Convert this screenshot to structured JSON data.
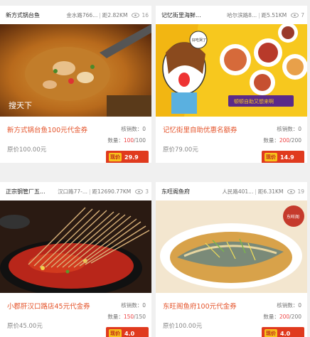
{
  "cards": [
    {
      "shop": "新方式锅台鱼",
      "address": "金水路766...",
      "distance": "距2.82KM",
      "views": "16",
      "title": "新方式锅台鱼100元代金券",
      "sold_label": "核销数：0",
      "qty_label": "数量：",
      "qty_used": "100",
      "qty_total": "/100",
      "original": "原价100.00元",
      "price_tag": "现价",
      "price": "29.9",
      "watermark": "搜天下"
    },
    {
      "shop": "记忆街里海鲜...",
      "address": "哈尔滨路8...",
      "distance": "距5.51KM",
      "views": "7",
      "title": "记忆街里自助优惠名额券",
      "sold_label": "核销数：0",
      "qty_label": "数量：",
      "qty_used": "200",
      "qty_total": "/200",
      "original": "原价79.00元",
      "price_tag": "现价",
      "price": "14.9",
      "bubble": "好吃哭了",
      "banner": "顿顿自助又想来啊"
    },
    {
      "shop": "正宗钢管厂五...",
      "address": "汉口路77-...",
      "distance": "距12690.77KM",
      "views": "3",
      "title": "小郡肝汉口路店45元代金券",
      "sold_label": "核销数：0",
      "qty_label": "数量：",
      "qty_used": "150",
      "qty_total": "/150",
      "original": "原价45.00元",
      "price_tag": "现价",
      "price": "4.0"
    },
    {
      "shop": "东旺阁鱼府",
      "address": "人民路401...",
      "distance": "距6.31KM",
      "views": "19",
      "title": "东旺阁鱼府100元代金券",
      "sold_label": "核销数：0",
      "qty_label": "数量：",
      "qty_used": "200",
      "qty_total": "/200",
      "original": "原价100.00元",
      "price_tag": "现价",
      "price": "4.0",
      "stamp": "东旺阁"
    }
  ],
  "colors": {
    "accent": "#e4532a",
    "price_bg": "#e03a1e",
    "tag_bg": "#f6c21b"
  }
}
